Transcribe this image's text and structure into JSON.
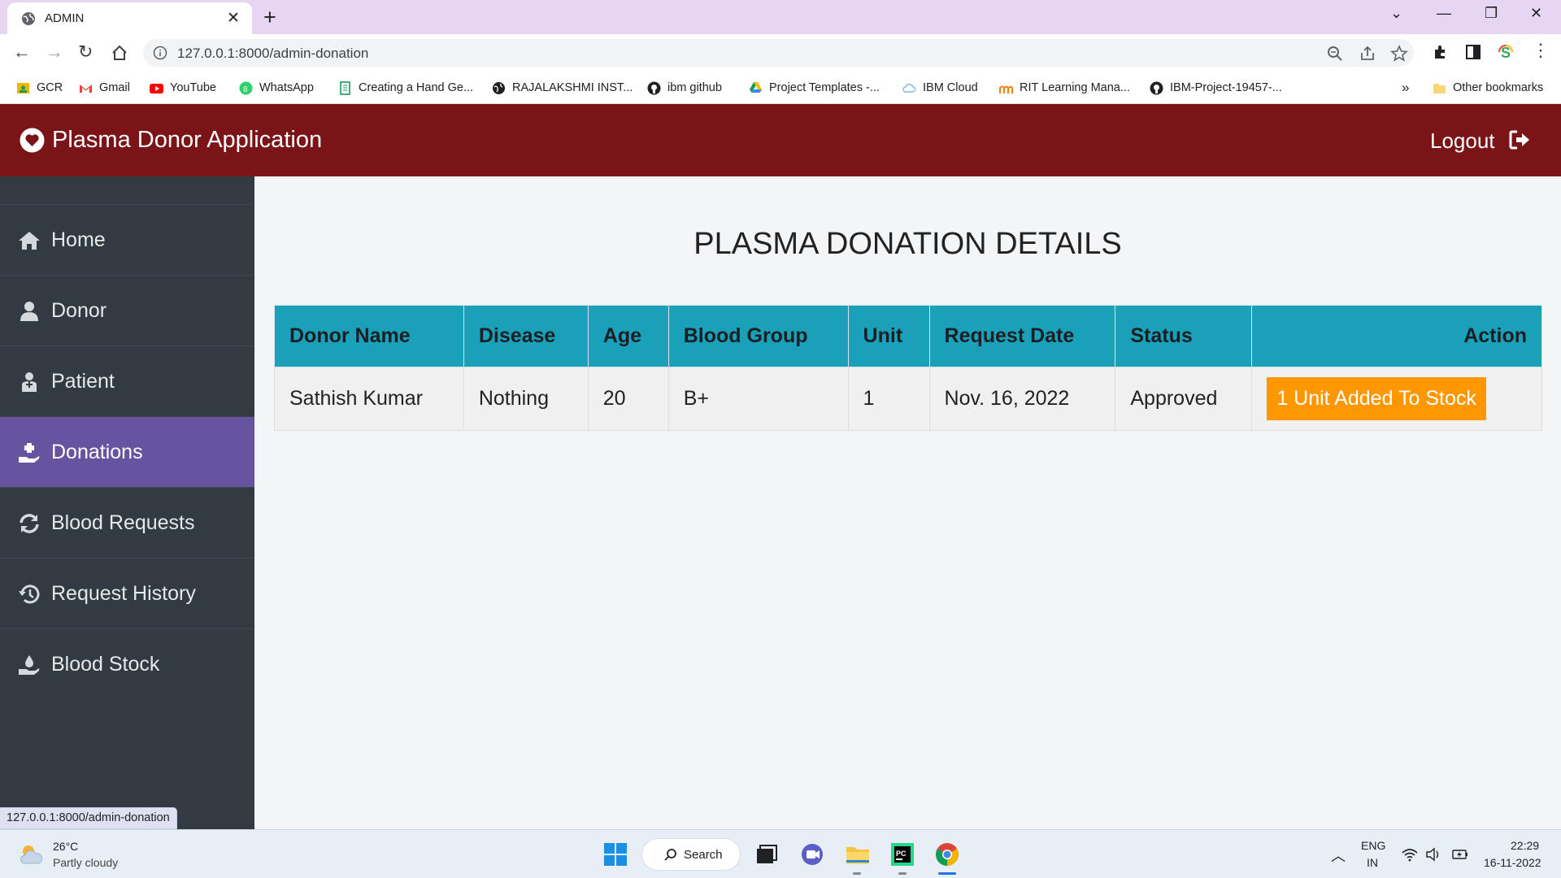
{
  "browser": {
    "tab_title": "ADMIN",
    "url": "127.0.0.1:8000/admin-donation",
    "bookmarks": [
      {
        "label": "GCR",
        "icon": "google-classroom-icon"
      },
      {
        "label": "Gmail",
        "icon": "gmail-icon"
      },
      {
        "label": "YouTube",
        "icon": "youtube-icon"
      },
      {
        "label": "WhatsApp",
        "icon": "whatsapp-icon"
      },
      {
        "label": "Creating a Hand Ge...",
        "icon": "document-icon"
      },
      {
        "label": "RAJALAKSHMI INST...",
        "icon": "globe-icon"
      },
      {
        "label": "ibm github",
        "icon": "github-icon"
      },
      {
        "label": "Project Templates -...",
        "icon": "google-drive-icon"
      },
      {
        "label": "IBM Cloud",
        "icon": "cloud-icon"
      },
      {
        "label": "RIT Learning Mana...",
        "icon": "moodle-icon"
      },
      {
        "label": "IBM-Project-19457-...",
        "icon": "github-icon"
      }
    ],
    "more_bookmarks": "»",
    "other_bookmarks": "Other bookmarks"
  },
  "app": {
    "brand": "Plasma Donor Application",
    "logout_label": "Logout",
    "colors": {
      "header": "#7b1417",
      "sidebar": "#323a42",
      "active": "#6754a1",
      "table_header": "#1aa0b8",
      "action": "#ff9800"
    }
  },
  "sidebar": {
    "items": [
      {
        "label": "Home",
        "icon": "home-icon"
      },
      {
        "label": "Donor",
        "icon": "user-icon"
      },
      {
        "label": "Patient",
        "icon": "patient-icon"
      },
      {
        "label": "Donations",
        "icon": "donation-hand-icon",
        "active": true
      },
      {
        "label": "Blood Requests",
        "icon": "sync-icon"
      },
      {
        "label": "Request History",
        "icon": "history-icon"
      },
      {
        "label": "Blood Stock",
        "icon": "stock-hand-icon"
      }
    ]
  },
  "main": {
    "title": "PLASMA DONATION DETAILS",
    "columns": [
      "Donor Name",
      "Disease",
      "Age",
      "Blood Group",
      "Unit",
      "Request Date",
      "Status",
      "Action"
    ],
    "rows": [
      {
        "donor_name": "Sathish Kumar",
        "disease": "Nothing",
        "age": "20",
        "blood_group": "B+",
        "unit": "1",
        "request_date": "Nov. 16, 2022",
        "status": "Approved",
        "action": "1 Unit Added To Stock"
      }
    ]
  },
  "status_bar_url": "127.0.0.1:8000/admin-donation",
  "taskbar": {
    "temperature": "26°C",
    "condition": "Partly cloudy",
    "search_label": "Search",
    "lang_line1": "ENG",
    "lang_line2": "IN",
    "time": "22:29",
    "date": "16-11-2022"
  }
}
